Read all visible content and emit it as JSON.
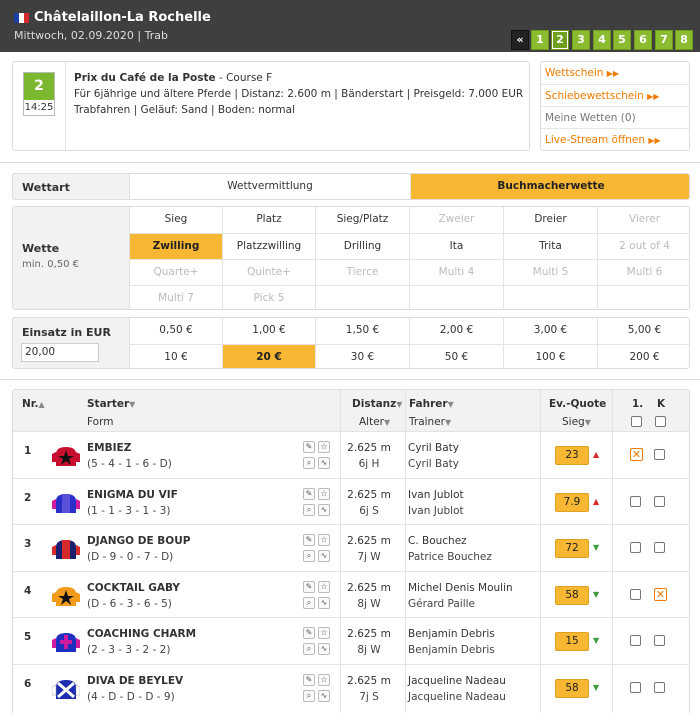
{
  "header": {
    "title": "Châtelaillon-La Rochelle",
    "date": "Mittwoch, 02.09.2020",
    "type": "Trab",
    "flag_colors": [
      "#1a3fa0",
      "#ffffff",
      "#d42a2a"
    ],
    "pages": [
      "«",
      "1",
      "2",
      "3",
      "4",
      "5",
      "6",
      "7",
      "8"
    ]
  },
  "race": {
    "number": "2",
    "time": "14:25",
    "name": "Prix du Café de la Poste",
    "course": " - Course F",
    "line2": "Für 6jährige und ältere Pferde  |  Distanz: 2.600 m  |  Bänderstart  |  Preisgeld: 7.000 EUR",
    "line3": "Trabfahren  |  Geläuf: Sand  |  Boden: normal"
  },
  "links": {
    "wettschein": "Wettschein",
    "schiebewettschein": "Schiebewettschein",
    "meine_wetten": "Meine Wetten (0)",
    "livestream": "Live-Stream öffnen"
  },
  "wettart": {
    "label": "Wettart",
    "options": [
      "Wettvermittlung",
      "Buchmacherwette"
    ],
    "selected": "Buchmacherwette"
  },
  "wette": {
    "label": "Wette",
    "min": "min. 0,50 €",
    "rows": [
      [
        "Sieg",
        "Platz",
        "Sieg/Platz",
        "Zweier",
        "Dreier",
        "Vierer"
      ],
      [
        "Zwilling",
        "Platzzwilling",
        "Drilling",
        "Ita",
        "Trita",
        "2 out of 4"
      ],
      [
        "Quarte+",
        "Quinte+",
        "Tierce",
        "Multi 4",
        "Multi 5",
        "Multi 6"
      ],
      [
        "Multi 7",
        "Pick 5",
        "",
        "",
        "",
        ""
      ]
    ],
    "selected": "Zwilling"
  },
  "einsatz": {
    "label": "Einsatz in EUR",
    "value": "20,00",
    "rows": [
      [
        "0,50 €",
        "1,00 €",
        "1,50 €",
        "2,00 €",
        "3,00 €",
        "5,00 €"
      ],
      [
        "10 €",
        "20 €",
        "30 €",
        "50 €",
        "100 €",
        "200 €"
      ]
    ],
    "selected": "20 €"
  },
  "table": {
    "headers": {
      "nr": "Nr.",
      "starter": "Starter",
      "form": "Form",
      "distanz": "Distanz",
      "alter": "Alter",
      "fahrer": "Fahrer",
      "trainer": "Trainer",
      "quote": "Ev.-Quote",
      "sieg": "Sieg",
      "first": "1.",
      "k": "K"
    },
    "rows": [
      {
        "nr": "1",
        "name": "EMBIEZ",
        "form": "(5 - 4 - 1 - 6 - D)",
        "dist": "2.625 m",
        "alter": "6j H",
        "fahrer": "Cyril Baty",
        "trainer": "Cyril Baty",
        "quote": "23",
        "trend": "up"
      },
      {
        "nr": "2",
        "name": "ENIGMA DU VIF",
        "form": "(1 - 1 - 3 - 1 - 3)",
        "dist": "2.625 m",
        "alter": "6j S",
        "fahrer": "Ivan Jublot",
        "trainer": "Ivan Jublot",
        "quote": "7.9",
        "trend": "up"
      },
      {
        "nr": "3",
        "name": "DJANGO DE BOUP",
        "form": "(D - 9 - 0 - 7 - D)",
        "dist": "2.625 m",
        "alter": "7j W",
        "fahrer": "C. Bouchez",
        "trainer": "Patrice Bouchez",
        "quote": "72",
        "trend": "down"
      },
      {
        "nr": "4",
        "name": "COCKTAIL GABY",
        "form": "(D - 6 - 3 - 6 - 5)",
        "dist": "2.625 m",
        "alter": "8j W",
        "fahrer": "Michel Denis Moulin",
        "trainer": "Gérard Paille",
        "quote": "58",
        "trend": "down"
      },
      {
        "nr": "5",
        "name": "COACHING CHARM",
        "form": "(2 - 3 - 3 - 2 - 2)",
        "dist": "2.625 m",
        "alter": "8j W",
        "fahrer": "Benjamin Debris",
        "trainer": "Benjamin Debris",
        "quote": "15",
        "trend": "down"
      },
      {
        "nr": "6",
        "name": "DIVA DE BEYLEV",
        "form": "(4 - D - D - D - 9)",
        "dist": "2.625 m",
        "alter": "7j S",
        "fahrer": "Jacqueline Nadeau",
        "trainer": "Jacqueline Nadeau",
        "quote": "58",
        "trend": "down"
      }
    ]
  },
  "colors": {
    "header_bg": "#3f3f3f",
    "green": "#8bbb2e",
    "accent": "#f8b733",
    "link_orange": "#f07b00"
  }
}
